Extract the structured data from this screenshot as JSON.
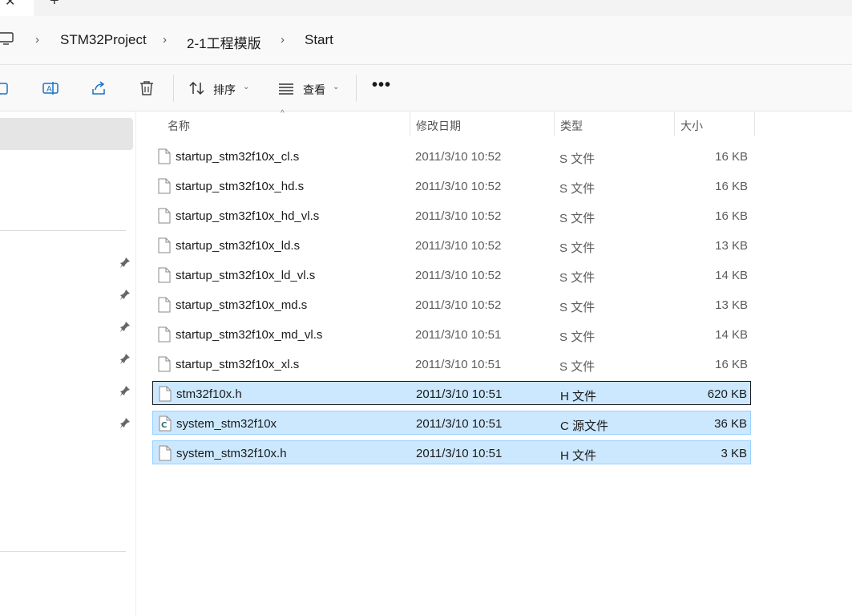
{
  "tabs": {
    "close_glyph": "✕",
    "new_glyph": "+"
  },
  "breadcrumb": {
    "icon": "computer-icon",
    "items": [
      "STM32Project",
      "2-1工程模版",
      "Start"
    ],
    "separator": "›"
  },
  "toolbar": {
    "icons": [
      "copy-icon",
      "rename-icon",
      "share-icon",
      "delete-icon"
    ],
    "sort_label": "排序",
    "view_label": "查看",
    "more_label": "•••",
    "caret": "⌄"
  },
  "navigation": {
    "pinned_count": 6,
    "icon": "pin-icon"
  },
  "columns": {
    "name": "名称",
    "date": "修改日期",
    "type": "类型",
    "size": "大小",
    "sort_indicator": "^"
  },
  "files": [
    {
      "name": "startup_stm32f10x_cl.s",
      "date": "2011/3/10 10:52",
      "type": "S 文件",
      "size": "16 KB",
      "icon": "file-icon",
      "selected": false
    },
    {
      "name": "startup_stm32f10x_hd.s",
      "date": "2011/3/10 10:52",
      "type": "S 文件",
      "size": "16 KB",
      "icon": "file-icon",
      "selected": false
    },
    {
      "name": "startup_stm32f10x_hd_vl.s",
      "date": "2011/3/10 10:52",
      "type": "S 文件",
      "size": "16 KB",
      "icon": "file-icon",
      "selected": false
    },
    {
      "name": "startup_stm32f10x_ld.s",
      "date": "2011/3/10 10:52",
      "type": "S 文件",
      "size": "13 KB",
      "icon": "file-icon",
      "selected": false
    },
    {
      "name": "startup_stm32f10x_ld_vl.s",
      "date": "2011/3/10 10:52",
      "type": "S 文件",
      "size": "14 KB",
      "icon": "file-icon",
      "selected": false
    },
    {
      "name": "startup_stm32f10x_md.s",
      "date": "2011/3/10 10:52",
      "type": "S 文件",
      "size": "13 KB",
      "icon": "file-icon",
      "selected": false
    },
    {
      "name": "startup_stm32f10x_md_vl.s",
      "date": "2011/3/10 10:51",
      "type": "S 文件",
      "size": "14 KB",
      "icon": "file-icon",
      "selected": false
    },
    {
      "name": "startup_stm32f10x_xl.s",
      "date": "2011/3/10 10:51",
      "type": "S 文件",
      "size": "16 KB",
      "icon": "file-icon",
      "selected": false
    },
    {
      "name": "stm32f10x.h",
      "date": "2011/3/10 10:51",
      "type": "H 文件",
      "size": "620 KB",
      "icon": "file-icon",
      "selected": true
    },
    {
      "name": "system_stm32f10x",
      "date": "2011/3/10 10:51",
      "type": "C 源文件",
      "size": "36 KB",
      "icon": "c-source-file-icon",
      "selected": true
    },
    {
      "name": "system_stm32f10x.h",
      "date": "2011/3/10 10:51",
      "type": "H 文件",
      "size": "3 KB",
      "icon": "file-icon",
      "selected": true
    }
  ],
  "colors": {
    "selection_fill": "#cce8ff",
    "selection_border": "#99d1ff",
    "toolbar_bg": "#f9f9f9",
    "nav_selected": "#e5e5e5"
  }
}
